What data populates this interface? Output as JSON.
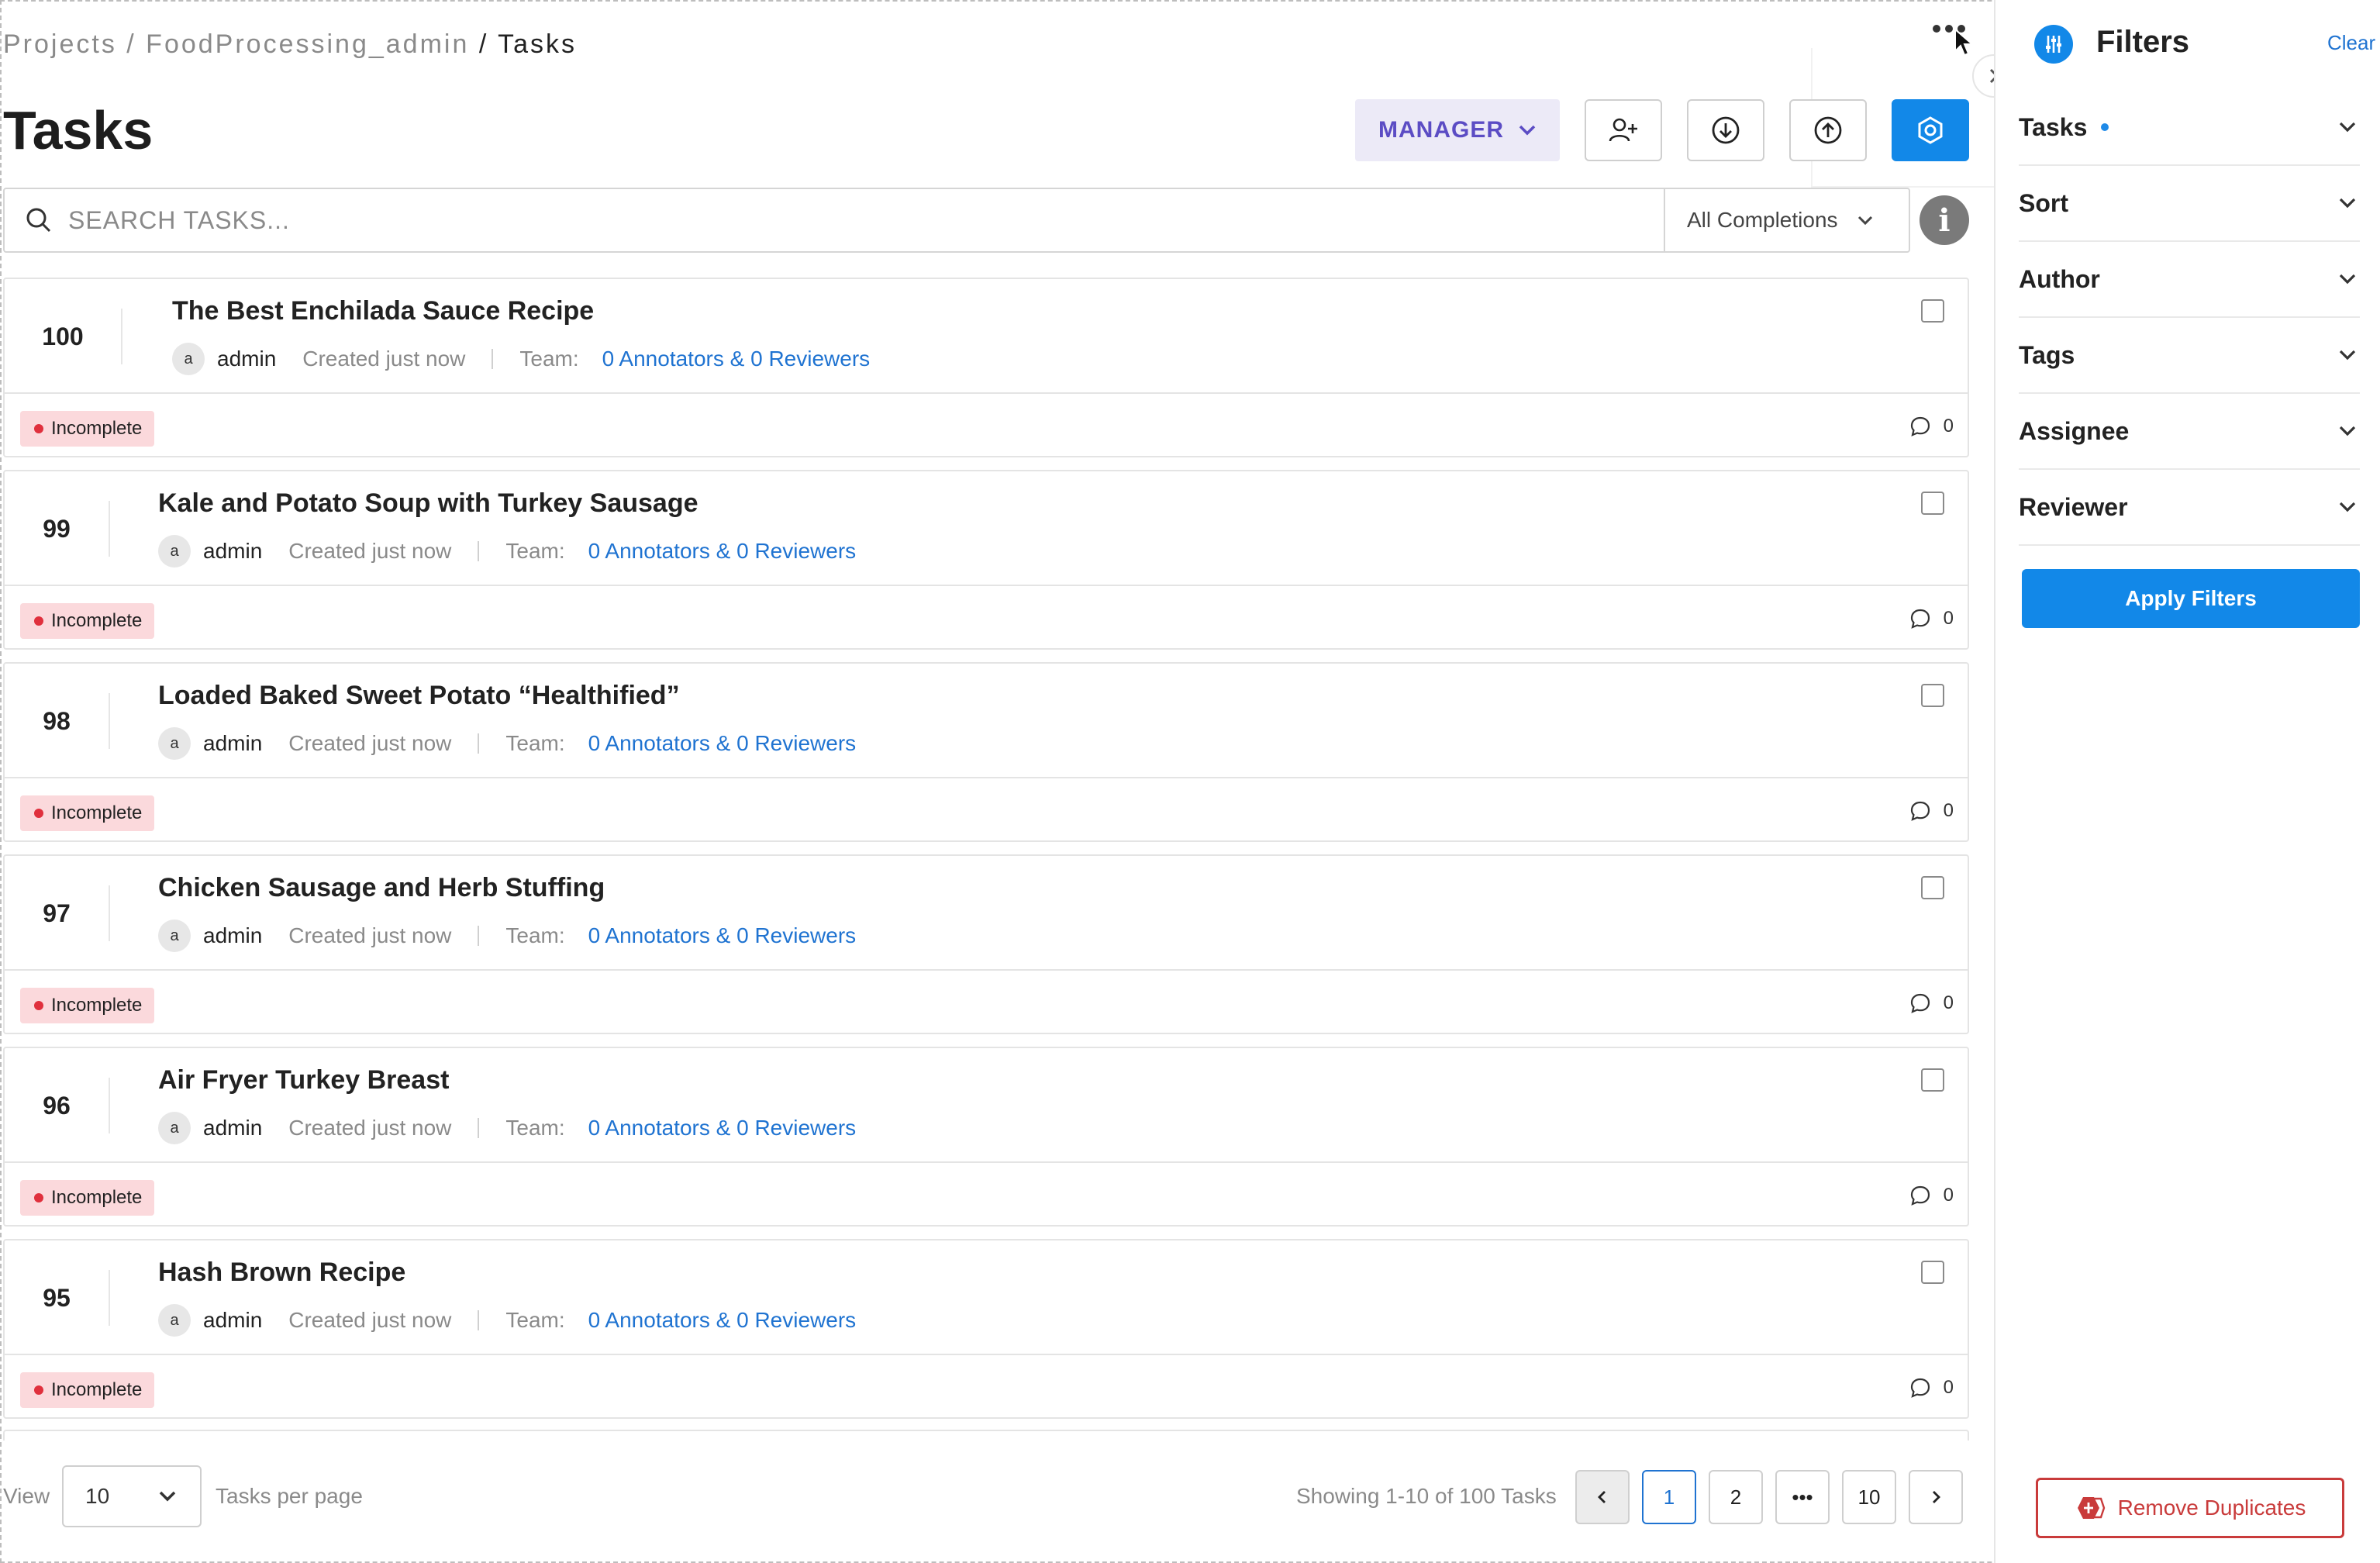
{
  "breadcrumb": {
    "projects": "Projects /",
    "project": "FoodProcessing_admin",
    "current": "/ Tasks"
  },
  "page": {
    "title": "Tasks"
  },
  "toolbar": {
    "role_label": "MANAGER",
    "icons": [
      "add-user-icon",
      "download-icon",
      "upload-icon",
      "settings-icon"
    ],
    "accent_color": "#1288e8"
  },
  "search": {
    "placeholder": "SEARCH TASKS...",
    "value": "",
    "completions_filter": "All Completions"
  },
  "tasks": [
    {
      "id": "100",
      "title": "The Best Enchilada Sauce Recipe",
      "avatar": "a",
      "author": "admin",
      "created": "Created just now",
      "team_label": "Team:",
      "team": "0 Annotators & 0 Reviewers",
      "status": "Incomplete",
      "comments": "0"
    },
    {
      "id": "99",
      "title": "Kale and Potato Soup with Turkey Sausage",
      "avatar": "a",
      "author": "admin",
      "created": "Created just now",
      "team_label": "Team:",
      "team": "0 Annotators & 0 Reviewers",
      "status": "Incomplete",
      "comments": "0"
    },
    {
      "id": "98",
      "title": "Loaded Baked Sweet Potato “Healthified”",
      "avatar": "a",
      "author": "admin",
      "created": "Created just now",
      "team_label": "Team:",
      "team": "0 Annotators & 0 Reviewers",
      "status": "Incomplete",
      "comments": "0"
    },
    {
      "id": "97",
      "title": "Chicken Sausage and Herb Stuffing",
      "avatar": "a",
      "author": "admin",
      "created": "Created just now",
      "team_label": "Team:",
      "team": "0 Annotators & 0 Reviewers",
      "status": "Incomplete",
      "comments": "0"
    },
    {
      "id": "96",
      "title": "Air Fryer Turkey Breast",
      "avatar": "a",
      "author": "admin",
      "created": "Created just now",
      "team_label": "Team:",
      "team": "0 Annotators & 0 Reviewers",
      "status": "Incomplete",
      "comments": "0"
    },
    {
      "id": "95",
      "title": "Hash Brown Recipe",
      "avatar": "a",
      "author": "admin",
      "created": "Created just now",
      "team_label": "Team:",
      "team": "0 Annotators & 0 Reviewers",
      "status": "Incomplete",
      "comments": "0"
    }
  ],
  "footer": {
    "view_label": "View",
    "per_page": "10",
    "per_page_label": "Tasks per page",
    "showing": "Showing 1-10 of 100 Tasks",
    "pages": [
      "1",
      "2",
      "10"
    ],
    "ellipsis": "•••",
    "current_page": "1"
  },
  "filters": {
    "title": "Filters",
    "clear": "Clear",
    "sections": [
      {
        "label": "Tasks",
        "active": true
      },
      {
        "label": "Sort",
        "active": false
      },
      {
        "label": "Author",
        "active": false
      },
      {
        "label": "Tags",
        "active": false
      },
      {
        "label": "Assignee",
        "active": false
      },
      {
        "label": "Reviewer",
        "active": false
      }
    ],
    "apply_label": "Apply Filters",
    "remove_duplicates_label": "Remove Duplicates",
    "danger_color": "#c93b3b"
  }
}
